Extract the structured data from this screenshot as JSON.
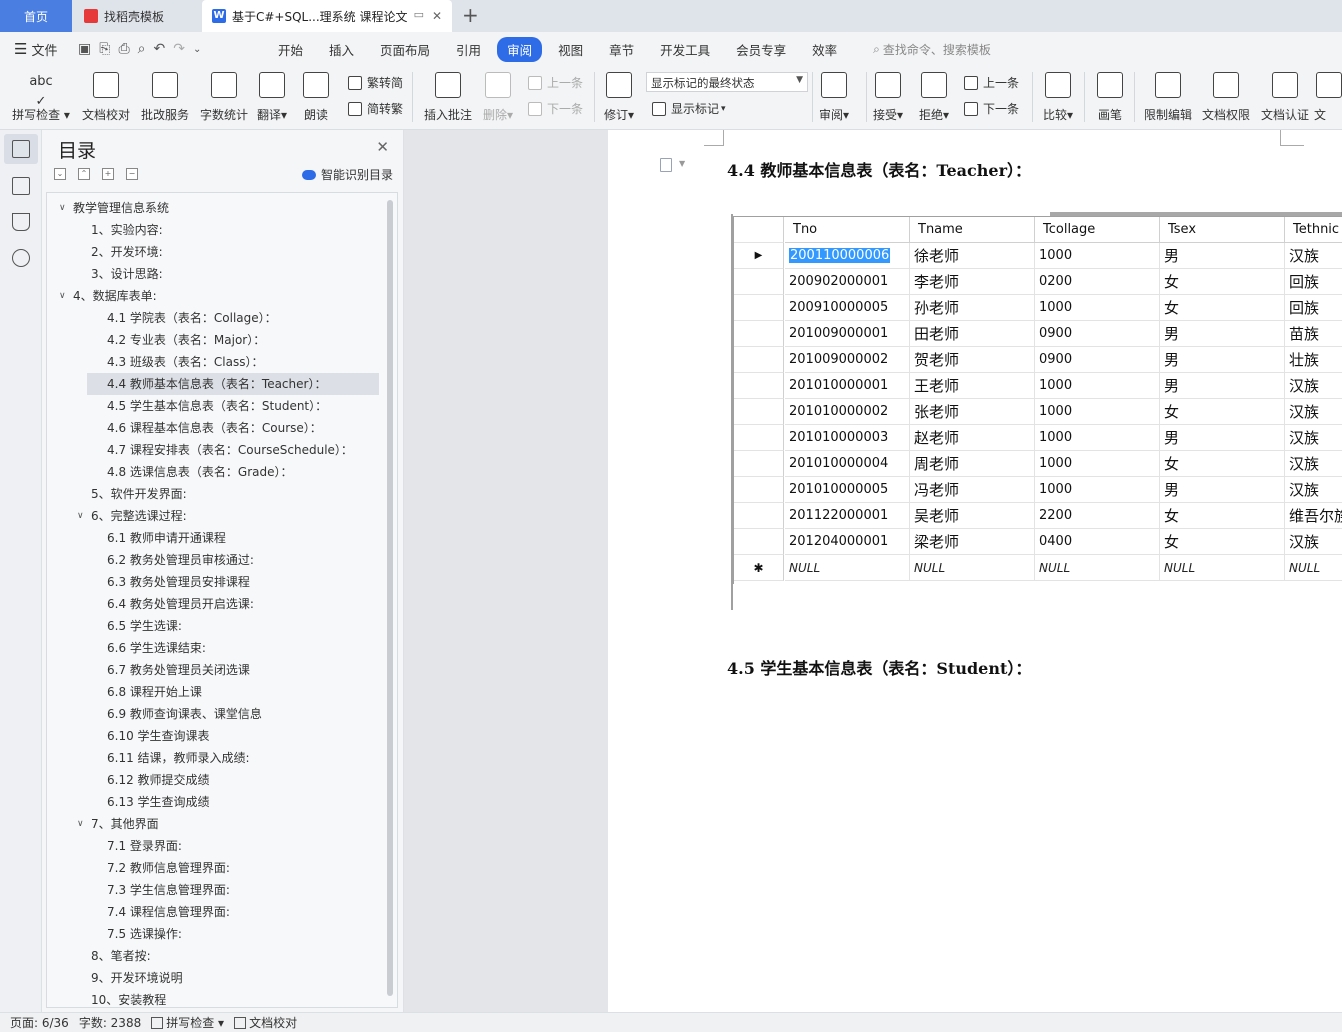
{
  "tabs": {
    "home": "首页",
    "template": "找稻壳模板",
    "document": "基于C#+SQL...理系统 课程论文"
  },
  "menu": {
    "file": "文件",
    "items": [
      "开始",
      "插入",
      "页面布局",
      "引用",
      "审阅",
      "视图",
      "章节",
      "开发工具",
      "会员专享",
      "效率"
    ],
    "active": "审阅",
    "search_placeholder": "查找命令、搜索模板"
  },
  "ribbon": {
    "spell_check": "拼写检查",
    "doc_proof": "文档校对",
    "annotate_service": "批改服务",
    "word_count": "字数统计",
    "translate": "翻译",
    "read_aloud": "朗读",
    "to_traditional": "繁转简",
    "to_simplified": "简转繁",
    "insert_comment": "插入批注",
    "delete": "删除",
    "prev_comment": "上一条",
    "next_comment": "下一条",
    "revise": "修订",
    "display_state": "显示标记的最终状态",
    "show_markup": "显示标记",
    "review": "审阅",
    "accept": "接受",
    "reject": "拒绝",
    "prev_change": "上一条",
    "next_change": "下一条",
    "compare": "比较",
    "pen": "画笔",
    "restrict_edit": "限制编辑",
    "doc_permission": "文档权限",
    "doc_cert": "文档认证",
    "doc_more": "文"
  },
  "toc": {
    "title": "目录",
    "smart": "智能识别目录",
    "items": [
      {
        "text": "教学管理信息系统",
        "level": 0,
        "arrow": "open"
      },
      {
        "text": "1、实验内容:",
        "level": 1
      },
      {
        "text": "2、开发环境:",
        "level": 1
      },
      {
        "text": "3、设计思路:",
        "level": 1
      },
      {
        "text": "4、数据库表单:",
        "level": 0,
        "arrow": "open"
      },
      {
        "text": "4.1  学院表（表名：Collage）：",
        "level": 2
      },
      {
        "text": "4.2  专业表（表名：Major）：",
        "level": 2
      },
      {
        "text": "4.3  班级表（表名：Class）：",
        "level": 2
      },
      {
        "text": "4.4  教师基本信息表（表名：Teacher）：",
        "level": 2,
        "selected": true
      },
      {
        "text": "4.5  学生基本信息表（表名：Student）：",
        "level": 2
      },
      {
        "text": "4.6  课程基本信息表（表名：Course）：",
        "level": 2
      },
      {
        "text": "4.7  课程安排表（表名：CourseSchedule）：",
        "level": 2
      },
      {
        "text": "4.8  选课信息表（表名：Grade）：",
        "level": 2
      },
      {
        "text": "5、软件开发界面:",
        "level": 1
      },
      {
        "text": "6、完整选课过程:",
        "level": 1,
        "arrow": "open"
      },
      {
        "text": "6.1  教师申请开通课程",
        "level": 2
      },
      {
        "text": "6.2  教务处管理员审核通过:",
        "level": 2
      },
      {
        "text": "6.3  教务处管理员安排课程",
        "level": 2
      },
      {
        "text": "6.4  教务处管理员开启选课:",
        "level": 2
      },
      {
        "text": "6.5  学生选课:",
        "level": 2
      },
      {
        "text": "6.6  学生选课结束:",
        "level": 2
      },
      {
        "text": "6.7  教务处管理员关闭选课",
        "level": 2
      },
      {
        "text": "6.8  课程开始上课",
        "level": 2
      },
      {
        "text": "6.9  教师查询课表、课堂信息",
        "level": 2
      },
      {
        "text": "6.10  学生查询课表",
        "level": 2
      },
      {
        "text": "6.11  结课，教师录入成绩:",
        "level": 2
      },
      {
        "text": "6.12  教师提交成绩",
        "level": 2
      },
      {
        "text": "6.13  学生查询成绩",
        "level": 2
      },
      {
        "text": "7、其他界面",
        "level": 1,
        "arrow": "open"
      },
      {
        "text": "7.1  登录界面:",
        "level": 2
      },
      {
        "text": "7.2  教师信息管理界面:",
        "level": 2
      },
      {
        "text": "7.3  学生信息管理界面:",
        "level": 2
      },
      {
        "text": "7.4  课程信息管理界面:",
        "level": 2
      },
      {
        "text": "7.5  选课操作:",
        "level": 2
      },
      {
        "text": "8、笔者按:",
        "level": 1
      },
      {
        "text": "9、开发环境说明",
        "level": 1
      },
      {
        "text": "10、安装教程",
        "level": 1
      }
    ]
  },
  "document": {
    "heading_44": "4.4  教师基本信息表（表名：Teacher）：",
    "heading_45": "4.5  学生基本信息表（表名：Student）：",
    "grid": {
      "columns": [
        "Tno",
        "Tname",
        "Tcollage",
        "Tsex",
        "Tethnic"
      ],
      "rows": [
        [
          "200110000006",
          "徐老师",
          "1000",
          "男",
          "汉族"
        ],
        [
          "200902000001",
          "李老师",
          "0200",
          "女",
          "回族"
        ],
        [
          "200910000005",
          "孙老师",
          "1000",
          "女",
          "回族"
        ],
        [
          "201009000001",
          "田老师",
          "0900",
          "男",
          "苗族"
        ],
        [
          "201009000002",
          "贺老师",
          "0900",
          "男",
          "壮族"
        ],
        [
          "201010000001",
          "王老师",
          "1000",
          "男",
          "汉族"
        ],
        [
          "201010000002",
          "张老师",
          "1000",
          "女",
          "汉族"
        ],
        [
          "201010000003",
          "赵老师",
          "1000",
          "男",
          "汉族"
        ],
        [
          "201010000004",
          "周老师",
          "1000",
          "女",
          "汉族"
        ],
        [
          "201010000005",
          "冯老师",
          "1000",
          "男",
          "汉族"
        ],
        [
          "201122000001",
          "吴老师",
          "2200",
          "女",
          "维吾尔族"
        ],
        [
          "201204000001",
          "梁老师",
          "0400",
          "女",
          "汉族"
        ]
      ],
      "null_label": "NULL",
      "current_marker": "▶",
      "new_marker": "✱"
    }
  },
  "status": {
    "page": "页面: 6/36",
    "words": "字数: 2388",
    "spell": "拼写检查",
    "proof": "文档校对"
  }
}
